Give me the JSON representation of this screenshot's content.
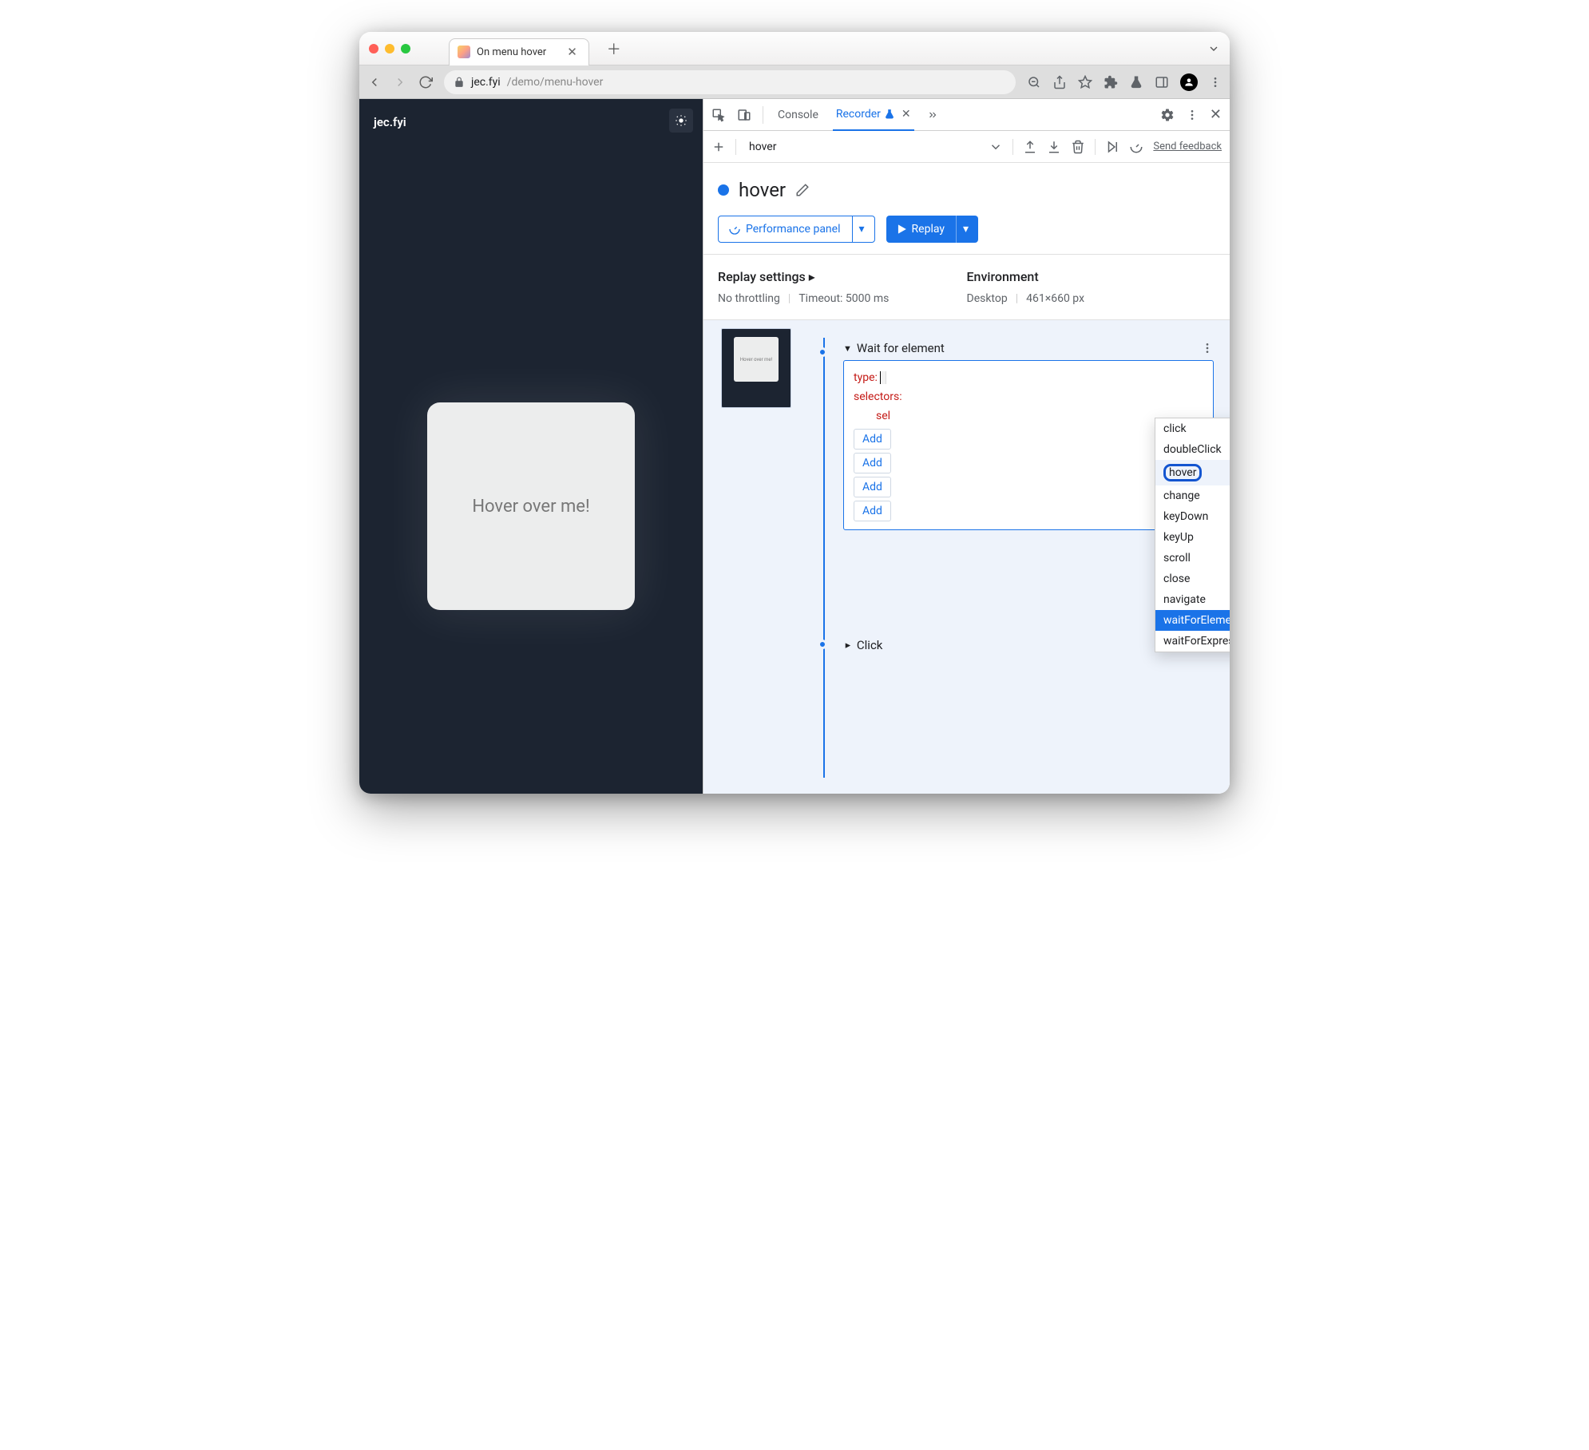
{
  "browser": {
    "tab_title": "On menu hover",
    "url_domain": "jec.fyi",
    "url_path": "/demo/menu-hover"
  },
  "page": {
    "site_title": "jec.fyi",
    "card_text": "Hover over me!"
  },
  "devtools": {
    "tabs": {
      "console": "Console",
      "recorder": "Recorder"
    },
    "toolbar": {
      "recording_name": "hover",
      "feedback": "Send feedback"
    },
    "rec_title": "hover",
    "buttons": {
      "perf": "Performance panel",
      "replay": "Replay"
    },
    "settings": {
      "replay_heading": "Replay settings",
      "throttling": "No throttling",
      "timeout": "Timeout: 5000 ms",
      "env_heading": "Environment",
      "env_device": "Desktop",
      "env_size": "461×660 px"
    },
    "step1": {
      "title": "Wait for element",
      "kv_type": "type:",
      "kv_selectors": "selectors:",
      "kv_sel": "sel",
      "add": "Add"
    },
    "step2": {
      "title": "Click"
    },
    "thumb_text": "Hover over me!",
    "dropdown": {
      "options": [
        "click",
        "doubleClick",
        "hover",
        "change",
        "keyDown",
        "keyUp",
        "scroll",
        "close",
        "navigate",
        "waitForElement",
        "waitForExpression"
      ],
      "ring_index": 2,
      "highlight_index": 2,
      "selected_index": 9
    }
  }
}
